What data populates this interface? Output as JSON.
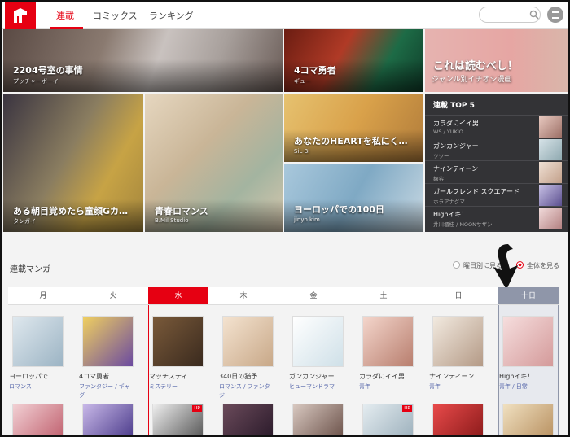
{
  "header": {
    "nav": [
      "連載",
      "コミックス",
      "ランキング"
    ],
    "search_placeholder": ""
  },
  "banners": [
    {
      "title": "2204号室の事情",
      "author": "プッチャーボーイ"
    },
    {
      "title": "4コマ勇者",
      "author": "ギュー"
    },
    {
      "title": "これは読むべし！",
      "author": "ジャンル別イチオシ漫画"
    },
    {
      "title": "ある朝目覚めたら童顔Gカ…",
      "author": "タンガイ"
    },
    {
      "title": "青春ロマンス",
      "author": "B.Mil Studio"
    },
    {
      "title": "あなたのHEARTを私にく…",
      "author": "SiL-Bi"
    },
    {
      "title": "ヨーロッパでの100日",
      "author": "jinyo kim"
    }
  ],
  "top5": {
    "title": "連載 TOP 5",
    "items": [
      {
        "title": "カラダにイイ男",
        "author": "WS / YUKIO"
      },
      {
        "title": "ガンカンジャー",
        "author": "ツツー"
      },
      {
        "title": "ナインティーン",
        "author": "麹谷"
      },
      {
        "title": "ガールフレンド スクエアード",
        "author": "ホラアナグマ"
      },
      {
        "title": "Highイキ！",
        "author": "井川櫃桂 / MOONサザン"
      }
    ]
  },
  "list": {
    "title": "連載マンガ",
    "option_by_day": "曜日別に見る",
    "option_all": "全体を見る"
  },
  "days": [
    "月",
    "火",
    "水",
    "木",
    "金",
    "土",
    "日",
    "十日"
  ],
  "items": [
    {
      "name": "ヨーロッパで…",
      "genre": "ロマンス",
      "genre2": ""
    },
    {
      "name": "4コマ勇者",
      "genre": "ファンタジー / ギャ",
      "genre2": "グ"
    },
    {
      "name": "マッチスティ…",
      "genre": "ミステリー",
      "genre2": ""
    },
    {
      "name": "340日の猶予",
      "genre": "ロマンス / ファンタ",
      "genre2": "ジー"
    },
    {
      "name": "ガンカンジャー",
      "genre": "ヒューマンドラマ",
      "genre2": ""
    },
    {
      "name": "カラダにイイ男",
      "genre": "青年",
      "genre2": ""
    },
    {
      "name": "ナインティーン",
      "genre": "青年",
      "genre2": ""
    },
    {
      "name": "Highイキ！",
      "genre": "青年 / 日常",
      "genre2": ""
    }
  ],
  "badge_up": "UP",
  "colors": {
    "accent": "#e60012",
    "last_day": "#8f96a9",
    "panel": "#333336"
  }
}
